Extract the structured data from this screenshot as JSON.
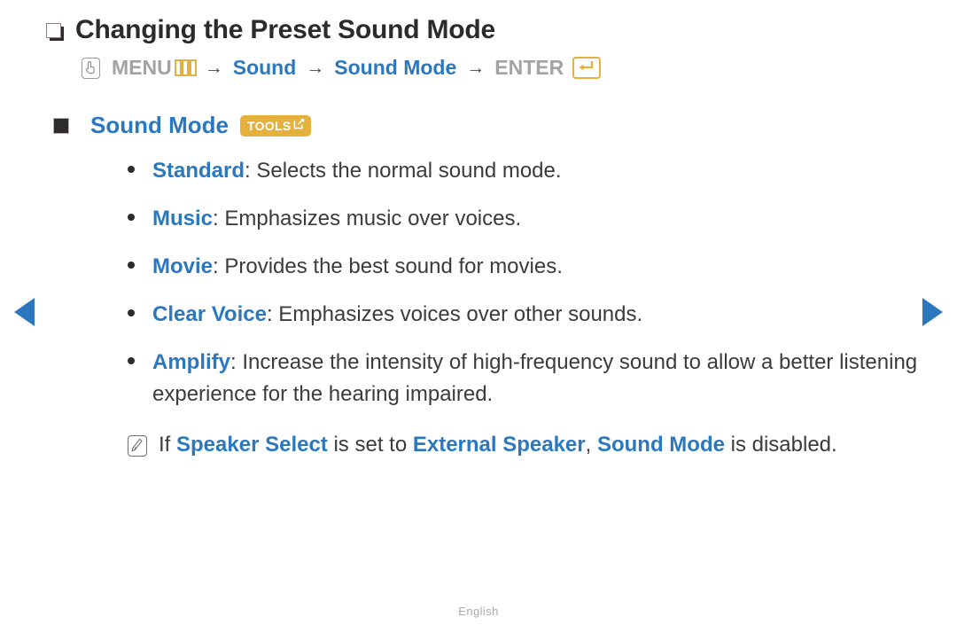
{
  "nav": {
    "prev_label": "Previous page",
    "next_label": "Next page"
  },
  "heading": {
    "title": "Changing the Preset Sound Mode",
    "bullet_icon": "shadow-square-icon"
  },
  "menu_path": {
    "press_icon": "press-button-icon",
    "menu_label": "MENU",
    "menu_glyph": "menu-bars-icon",
    "arrow": "→",
    "step_sound": "Sound",
    "step_sound_mode": "Sound Mode",
    "enter_label": "ENTER",
    "enter_glyph": "enter-return-icon"
  },
  "section": {
    "marker_icon": "filled-square-icon",
    "title": "Sound Mode",
    "badge": {
      "label": "TOOLS",
      "icon": "tools-arrow-icon",
      "color": "#E3B13C"
    }
  },
  "options": [
    {
      "name": "Standard",
      "description": ": Selects the normal sound mode."
    },
    {
      "name": "Music",
      "description": ": Emphasizes music over voices."
    },
    {
      "name": "Movie",
      "description": ": Provides the best sound for movies."
    },
    {
      "name": "Clear Voice",
      "description": ": Emphasizes voices over other sounds."
    },
    {
      "name": "Amplify",
      "description": ": Increase the intensity of high-frequency sound to allow a better listening experience for the hearing impaired."
    }
  ],
  "note": {
    "icon": "note-pencil-icon",
    "part1": "If ",
    "term1": "Speaker Select",
    "part2": " is set to ",
    "term2": "External Speaker",
    "part3": ", ",
    "term3": "Sound Mode",
    "part4": " is disabled."
  },
  "footer": {
    "language": "English"
  },
  "colors": {
    "accent_blue": "#2B78BE",
    "accent_gold": "#E3B13C",
    "text": "#3b3b3b",
    "muted": "#a0a0a0"
  }
}
